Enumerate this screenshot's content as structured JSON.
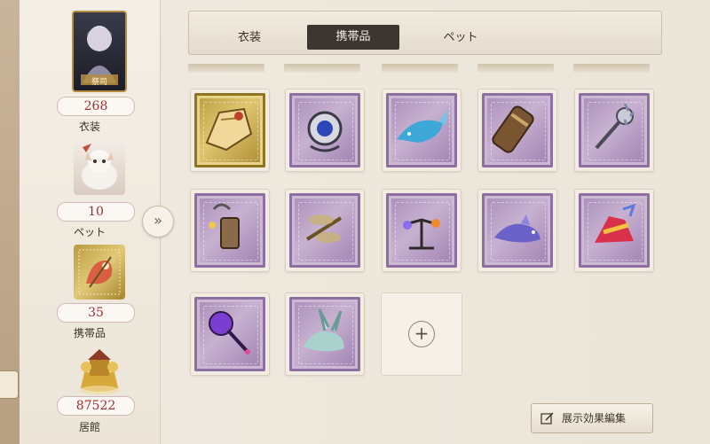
{
  "tabs": {
    "costume": "衣装",
    "accessory": "携帯品",
    "pet": "ペット",
    "active": "accessory"
  },
  "sidebar": {
    "character_name": "祭司",
    "costume_count": "268",
    "costume_label": "衣装",
    "pet_count": "10",
    "pet_label": "ペット",
    "accessory_count": "35",
    "accessory_label": "携帯品",
    "residence_count": "87522",
    "residence_label": "居館"
  },
  "expand_button": "»",
  "items": [
    {
      "name": "map-scroll",
      "frame": "gold"
    },
    {
      "name": "sapphire-ornament",
      "frame": "purple"
    },
    {
      "name": "blue-whale",
      "frame": "purple"
    },
    {
      "name": "leather-scroll-tube",
      "frame": "purple"
    },
    {
      "name": "silver-mace",
      "frame": "purple"
    },
    {
      "name": "hanging-lantern",
      "frame": "purple"
    },
    {
      "name": "brass-dragonfly",
      "frame": "purple"
    },
    {
      "name": "twin-lamps",
      "frame": "purple"
    },
    {
      "name": "violet-fox",
      "frame": "purple"
    },
    {
      "name": "festive-ribbon",
      "frame": "purple"
    },
    {
      "name": "crystal-scepter",
      "frame": "purple"
    },
    {
      "name": "ghost-rabbit",
      "frame": "purple"
    }
  ],
  "add_slot": "+",
  "display_button": "展示効果編集",
  "colors": {
    "accent_dark": "#3b3632",
    "count_red": "#9b2e2e",
    "stamp_purple": "#a78bb8",
    "stamp_gold": "#c9ad52"
  }
}
